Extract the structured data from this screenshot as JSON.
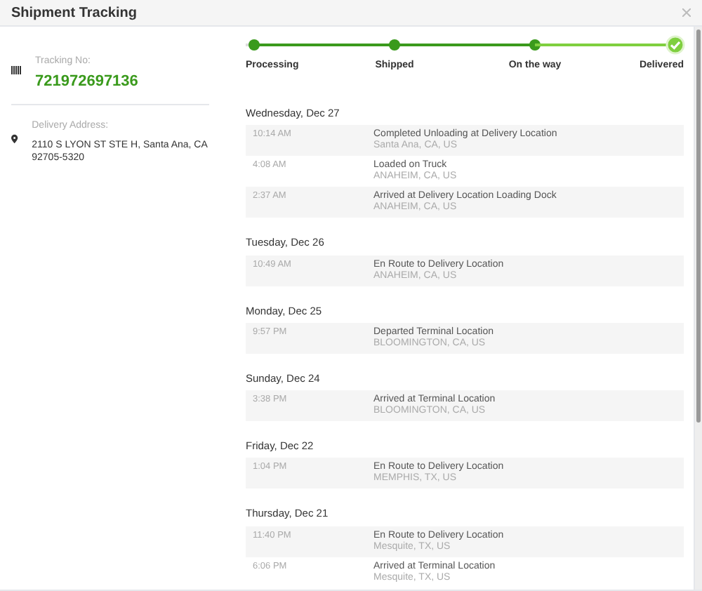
{
  "window": {
    "title": "Shipment Tracking"
  },
  "tracking": {
    "label": "Tracking No:",
    "number": "721972697136"
  },
  "address": {
    "label": "Delivery Address:",
    "value": "2110 S LYON ST STE H, Santa Ana, CA 92705-5320"
  },
  "steps": [
    {
      "label": "Processing",
      "completed": true,
      "current": false
    },
    {
      "label": "Shipped",
      "completed": true,
      "current": false
    },
    {
      "label": "On the way",
      "completed": true,
      "current": false
    },
    {
      "label": "Delivered",
      "completed": true,
      "current": true
    }
  ],
  "days": [
    {
      "date": "Wednesday, Dec 27",
      "events": [
        {
          "time": "10:14 AM",
          "status": "Completed Unloading at Delivery Location",
          "place": "Santa Ana, CA, US"
        },
        {
          "time": "4:08 AM",
          "status": "Loaded on Truck",
          "place": "ANAHEIM, CA, US"
        },
        {
          "time": "2:37 AM",
          "status": "Arrived at Delivery Location Loading Dock",
          "place": "ANAHEIM, CA, US"
        }
      ]
    },
    {
      "date": "Tuesday, Dec 26",
      "events": [
        {
          "time": "10:49 AM",
          "status": "En Route to Delivery Location",
          "place": "ANAHEIM, CA, US"
        }
      ]
    },
    {
      "date": "Monday, Dec 25",
      "events": [
        {
          "time": "9:57 PM",
          "status": "Departed Terminal Location",
          "place": "BLOOMINGTON, CA, US"
        }
      ]
    },
    {
      "date": "Sunday, Dec 24",
      "events": [
        {
          "time": "3:38 PM",
          "status": "Arrived at Terminal Location",
          "place": "BLOOMINGTON, CA, US"
        }
      ]
    },
    {
      "date": "Friday, Dec 22",
      "events": [
        {
          "time": "1:04 PM",
          "status": "En Route to Delivery Location",
          "place": "MEMPHIS, TX, US"
        }
      ]
    },
    {
      "date": "Thursday, Dec 21",
      "events": [
        {
          "time": "11:40 PM",
          "status": "En Route to Delivery Location",
          "place": "Mesquite, TX, US"
        },
        {
          "time": "6:06 PM",
          "status": "Arrived at Terminal Location",
          "place": "Mesquite, TX, US"
        }
      ]
    }
  ]
}
